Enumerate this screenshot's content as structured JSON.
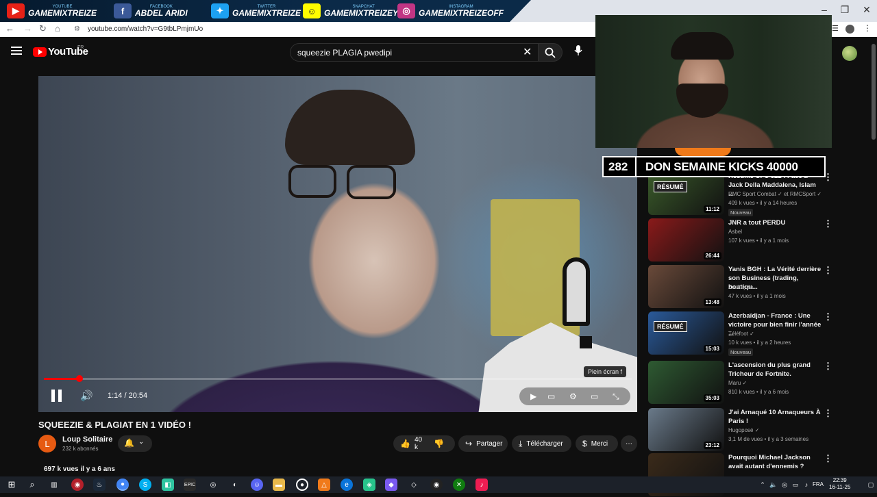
{
  "social_banner": {
    "items": [
      {
        "platform": "YOUTUBE",
        "handle": "GAMEMIXTREIZE",
        "icon": "youtube-icon",
        "color": "#e62117"
      },
      {
        "platform": "FACEBOOK",
        "handle": "ABDEL ARIDI",
        "icon": "facebook-icon",
        "color": "#3b5998"
      },
      {
        "platform": "TWITTER",
        "handle": "GAMEMIXTREIZE",
        "icon": "twitter-icon",
        "color": "#1da1f2"
      },
      {
        "platform": "SNAPCHAT",
        "handle": "GAMEMIXTREIZEYT",
        "icon": "snapchat-icon",
        "color": "#fffc00"
      },
      {
        "platform": "INSTAGRAM",
        "handle": "GAMEMIXTREIZEOFF",
        "icon": "instagram-icon",
        "color": "#c13584"
      }
    ]
  },
  "browser": {
    "url": "youtube.com/watch?v=G9tbLPmjmUo"
  },
  "youtube": {
    "logo_text": "YouTube",
    "region": "FR",
    "search_query": "squeezie PLAGIA pwedipi"
  },
  "player": {
    "progress": 0.056,
    "time_display": "1:14 / 20:54",
    "tooltip": "Plein écran  f"
  },
  "video": {
    "title": "SQUEEZIE & PLAGIAT EN 1 VIDÉO !",
    "channel": "Loup Solitaire",
    "channel_initial": "L",
    "subscribers": "232 k abonnés",
    "likes": "40 k",
    "share_label": "Partager",
    "download_label": "Télécharger",
    "thanks_label": "Merci",
    "views_date": "697 k vues  il y a 6 ans"
  },
  "overlay": {
    "donation_count": "282",
    "donation_label": "DON SEMAINE KICKS 40000"
  },
  "recommendations": [
    {
      "title": "Résumé UFC 322 : Face à Jack Della Maddalena, Islam ...",
      "channel": "RMC Sport Combat  ✓ et RMCSport ✓",
      "meta": "409 k vues • il y a 14 heures",
      "new": "Nouveau",
      "duration": "11:12",
      "badge": "RÉSUMÉ",
      "thumb_color": "#3a5a2a"
    },
    {
      "title": "JNR a tout PERDU",
      "channel": "Asbel",
      "meta": "107 k vues • il y a 1 mois",
      "new": "",
      "duration": "26:44",
      "badge": "",
      "thumb_color": "#8a1a1a"
    },
    {
      "title": "Yanis BGH : La Vérité derrière son Business (trading, boutiqu...",
      "channel": "Zoukayzie",
      "meta": "47 k vues • il y a 1 mois",
      "new": "",
      "duration": "13:48",
      "badge": "",
      "thumb_color": "#6a4a3a"
    },
    {
      "title": "Azerbaïdjan - France : Une victoire pour bien finir l'année ...",
      "channel": "Téléfoot ✓",
      "meta": "10 k vues • il y a 2 heures",
      "new": "Nouveau",
      "duration": "15:03",
      "badge": "RÉSUMÉ",
      "thumb_color": "#2a5a9a"
    },
    {
      "title": "L'ascension du plus grand Tricheur de Fortnite.",
      "channel": "Maru ✓",
      "meta": "810 k vues • il y a 6 mois",
      "new": "",
      "duration": "35:03",
      "badge": "",
      "thumb_color": "#2e5a32"
    },
    {
      "title": "J'ai Arnaqué 10 Arnaqueurs À Paris !",
      "channel": "Hugoposé ✓",
      "meta": "3,1 M de vues • il y a 3 semaines",
      "new": "",
      "duration": "23:12",
      "badge": "",
      "thumb_color": "#6a7a8a"
    },
    {
      "title": "Pourquoi Michael Jackson avait autant d'ennemis ?",
      "channel": "",
      "meta": "",
      "new": "",
      "duration": "",
      "badge": "",
      "thumb_color": "#3a2a1a"
    }
  ],
  "taskbar": {
    "language": "FRA",
    "time": "22:39",
    "date": "16-11-25"
  }
}
